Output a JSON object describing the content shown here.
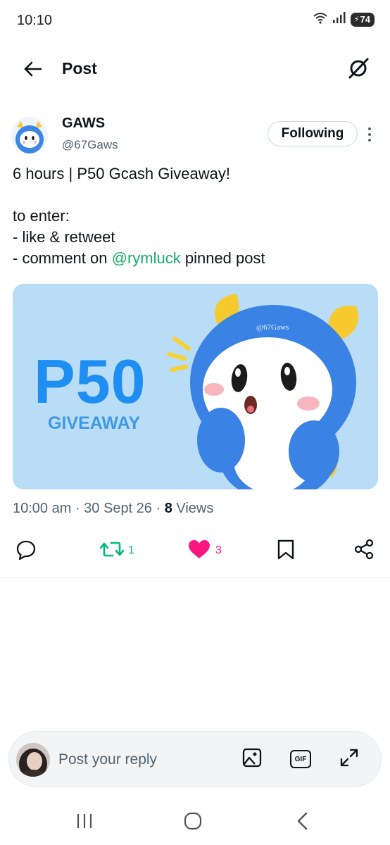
{
  "status_bar": {
    "time": "10:10",
    "battery": "74"
  },
  "header": {
    "title": "Post"
  },
  "post": {
    "author_name": "GAWS",
    "author_handle": "@67Gaws",
    "follow_label": "Following",
    "text": {
      "line1": "6 hours | P50 Gcash Giveaway!",
      "line2": "to enter:",
      "line3": "- like & retweet",
      "line4_prefix": "- comment on ",
      "line4_mention": "@rymluck",
      "line4_suffix": " pinned post"
    },
    "media": {
      "headline": "P50",
      "subline": "GIVEAWAY",
      "watermark": "@67Gaws"
    },
    "time": "10:00 am",
    "date": "30 Sept 26",
    "views_count": "8",
    "views_label": " Views",
    "retweet_count": "1",
    "like_count": "3"
  },
  "reply": {
    "placeholder": "Post your reply",
    "gif_label": "GIF"
  },
  "icons": {
    "back": "arrow-left-icon",
    "grok": "grok-icon",
    "more": "more-vertical-icon",
    "reply": "comment-icon",
    "retweet": "retweet-icon",
    "like": "heart-icon",
    "bookmark": "bookmark-icon",
    "share": "share-icon",
    "image": "image-icon",
    "gif": "gif-icon",
    "expand": "expand-icon"
  },
  "colors": {
    "text_primary": "#0f1419",
    "text_secondary": "#536471",
    "mention": "#1aab6d",
    "retweet_active": "#00ba7c",
    "like_active": "#f91880",
    "media_background": "#b9dcf7",
    "media_headline": "#1e8ef3"
  }
}
